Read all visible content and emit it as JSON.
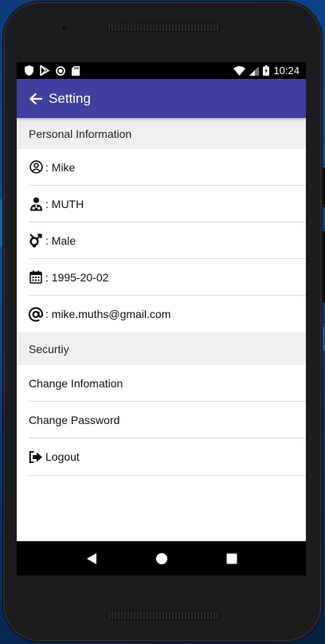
{
  "status_bar": {
    "time": "10:24",
    "left_icons": [
      "shield-icon",
      "play-store-icon",
      "circle-record-icon",
      "sd-card-icon"
    ],
    "right_icons": [
      "wifi-icon",
      "cell-signal-icon",
      "battery-icon"
    ]
  },
  "app_bar": {
    "title": "Setting",
    "back_icon": "arrow-left-icon"
  },
  "personal": {
    "header": "Personal Information",
    "name": ": Mike",
    "username": ": MUTH",
    "gender": ": Male",
    "birthday": ": 1995-20-02",
    "email": ": mike.muths@gmail.com"
  },
  "security": {
    "header": "Securtiy",
    "change_info": "Change Infomation",
    "change_password": "Change Password",
    "logout": "Logout"
  },
  "nav_bar": {
    "icons": [
      "back-triangle-icon",
      "home-circle-icon",
      "recents-square-icon"
    ]
  },
  "colors": {
    "app_bar": "#3f3fa0",
    "section_bg": "#efefef",
    "status_bar": "#000000"
  }
}
